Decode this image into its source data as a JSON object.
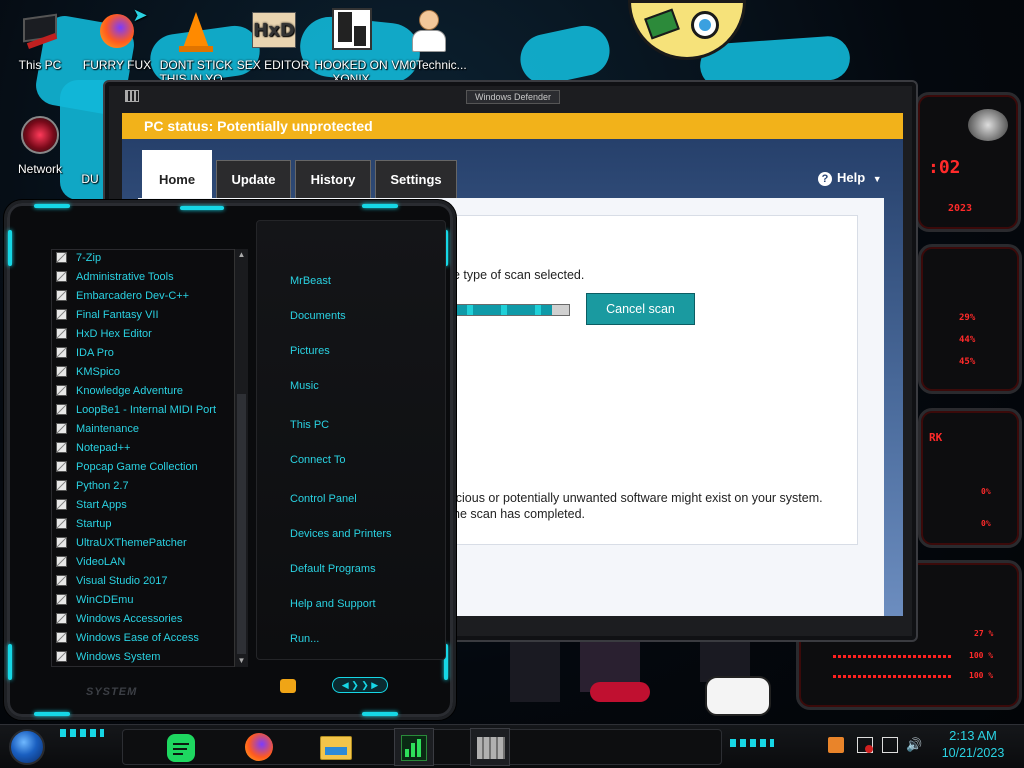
{
  "desktop": {
    "icons": [
      {
        "label": "This PC"
      },
      {
        "label": "FURRY FUX"
      },
      {
        "label": "DONT STICK"
      },
      {
        "label": "THIS IN YO..."
      },
      {
        "label": "SEX EDITOR"
      },
      {
        "label": "HOOKED ON"
      },
      {
        "label": "XONIX"
      },
      {
        "label": "VM0Technic..."
      },
      {
        "label": "Network"
      },
      {
        "label": "DU"
      }
    ],
    "widget_text": [
      ":02",
      "2023",
      "29%",
      "44%",
      "45%",
      "RK",
      "0%",
      "0%",
      "27 %",
      "100 %",
      "100 %"
    ]
  },
  "defender": {
    "title": "Windows Defender",
    "status_bar": "PC status: Potentially unprotected",
    "tabs": [
      {
        "label": "Home"
      },
      {
        "label": "Update"
      },
      {
        "label": "History"
      },
      {
        "label": "Settings"
      }
    ],
    "help_label": "Help",
    "scan_type_text": "e type of scan selected.",
    "cancel_scan_label": "Cancel scan",
    "scan_progress_fraction": 0.85,
    "warning_line_1": "icious or potentially unwanted software might exist on your system.",
    "warning_line_2": "he scan has completed."
  },
  "start_menu": {
    "programs": [
      {
        "label": "7-Zip"
      },
      {
        "label": "Administrative Tools"
      },
      {
        "label": "Embarcadero Dev-C++"
      },
      {
        "label": "Final Fantasy VII"
      },
      {
        "label": "HxD Hex Editor"
      },
      {
        "label": "IDA Pro"
      },
      {
        "label": "KMSpico"
      },
      {
        "label": "Knowledge Adventure"
      },
      {
        "label": "LoopBe1 - Internal MIDI Port"
      },
      {
        "label": "Maintenance"
      },
      {
        "label": "Notepad++"
      },
      {
        "label": "Popcap Game Collection"
      },
      {
        "label": "Python 2.7"
      },
      {
        "label": "Start Apps"
      },
      {
        "label": "Startup"
      },
      {
        "label": "UltraUXThemePatcher"
      },
      {
        "label": "VideoLAN"
      },
      {
        "label": "Visual Studio 2017"
      },
      {
        "label": "WinCDEmu"
      },
      {
        "label": "Windows Accessories"
      },
      {
        "label": "Windows Ease of Access"
      },
      {
        "label": "Windows System"
      }
    ],
    "places": [
      {
        "label": "MrBeast"
      },
      {
        "label": "Documents"
      },
      {
        "label": "Pictures"
      },
      {
        "label": "Music"
      },
      {
        "label": "This PC"
      },
      {
        "label": "Connect To"
      },
      {
        "label": "Control Panel"
      },
      {
        "label": "Devices and Printers"
      },
      {
        "label": "Default Programs"
      },
      {
        "label": "Help and Support"
      },
      {
        "label": "Run..."
      }
    ],
    "footer_label": "SYSTEM"
  },
  "taskbar": {
    "pinned": [
      {
        "icon": "spotify-icon"
      },
      {
        "icon": "firefox-icon"
      },
      {
        "icon": "file-explorer-icon"
      },
      {
        "icon": "task-manager-chart-icon"
      },
      {
        "icon": "castle-icon"
      }
    ],
    "clock_time": "2:13 AM",
    "clock_date": "10/21/2023"
  },
  "colors": {
    "accent_cyan": "#2ad2e2",
    "status_yellow": "#f2b21a",
    "defender_button": "#1a9aa0",
    "widget_red": "#ff2a2a"
  }
}
